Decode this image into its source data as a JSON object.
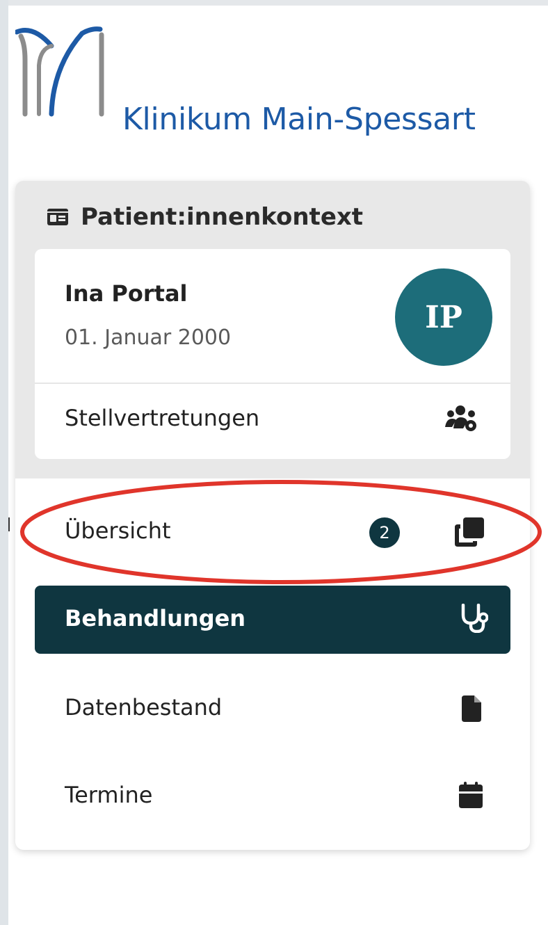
{
  "brand": {
    "name": "Klinikum Main-Spessart",
    "icon": "klinikum-logo-mark",
    "colors": {
      "blue": "#1d5aa6",
      "gray": "#8c8c8c"
    }
  },
  "context": {
    "title": "Patient:innenkontext",
    "icon": "id-card-icon"
  },
  "patient": {
    "name": "Ina Portal",
    "birth_date": "01. Januar 2000",
    "initials": "IP",
    "avatar_color": "#1d6d7a",
    "deputies_label": "Stellvertretungen",
    "deputies_icon": "users-gear-icon"
  },
  "nav": {
    "items": [
      {
        "label": "Übersicht",
        "icon": "clone-icon",
        "badge": "2",
        "active": false,
        "highlighted": true
      },
      {
        "label": "Behandlungen",
        "icon": "stethoscope-icon",
        "active": true
      },
      {
        "label": "Datenbestand",
        "icon": "file-icon",
        "active": false
      },
      {
        "label": "Termine",
        "icon": "calendar-icon",
        "active": false
      }
    ]
  },
  "colors": {
    "active_bg": "#0f3640",
    "annotation_red": "#e0352b",
    "panel_bg": "#e8e8e8"
  }
}
